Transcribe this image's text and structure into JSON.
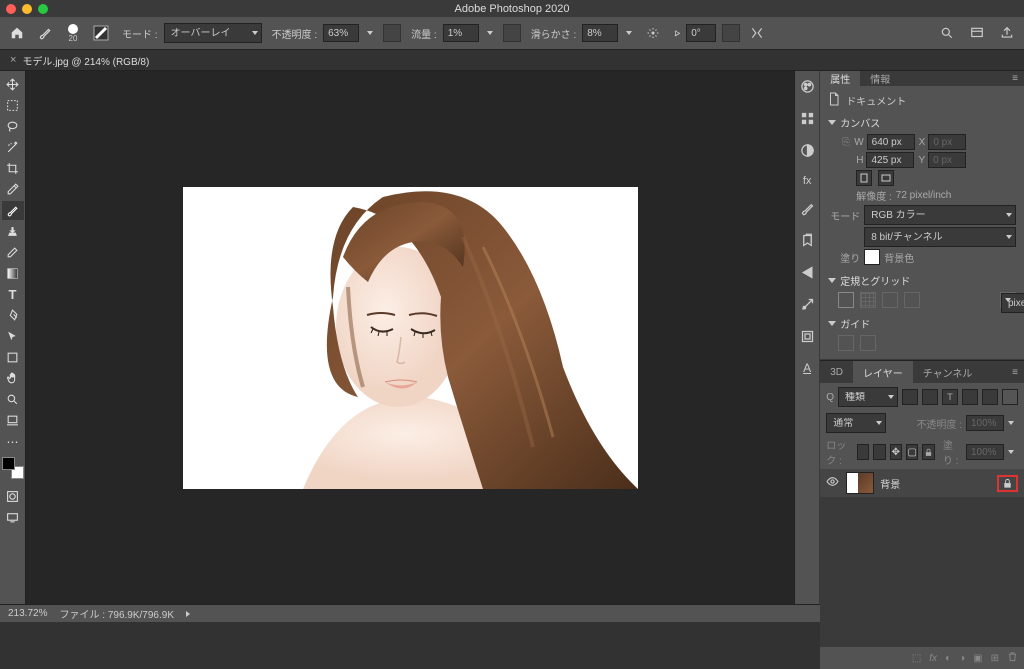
{
  "app_title": "Adobe Photoshop 2020",
  "document_tab": {
    "title": "モデル.jpg @ 214% (RGB/8)"
  },
  "options": {
    "brush_size": "20",
    "mode_label": "モード :",
    "mode_value": "オーバーレイ",
    "opacity_label": "不透明度 :",
    "opacity_value": "63%",
    "flow_label": "流量 :",
    "flow_value": "1%",
    "smoothing_label": "滑らかさ :",
    "smoothing_value": "8%",
    "angle_label": "⦠",
    "angle_value": "0°"
  },
  "properties": {
    "tab_properties": "属性",
    "tab_info": "情報",
    "doc_type": "ドキュメント",
    "canvas_label": "カンバス",
    "w_label": "W",
    "w_value": "640 px",
    "h_label": "H",
    "h_value": "425 px",
    "x_label": "X",
    "x_value": "0 px",
    "y_label": "Y",
    "y_value": "0 px",
    "resolution_label": "解像度 :",
    "resolution_value": "72 pixel/inch",
    "mode_label": "モード",
    "mode_value": "RGB カラー",
    "bit_value": "8 bit/チャンネル",
    "fill_label": "塗り",
    "fill_value": "背景色",
    "rulers_label": "定規とグリッド",
    "rulers_unit": "pixel",
    "guides_label": "ガイド"
  },
  "layers": {
    "tab_3d": "3D",
    "tab_layers": "レイヤー",
    "tab_channels": "チャンネル",
    "kind_label": "種類",
    "blend_mode": "通常",
    "opacity_label": "不透明度 :",
    "opacity_value": "100%",
    "lock_label": "ロック :",
    "fill_label": "塗り :",
    "fill_value": "100%",
    "layer_name": "背景"
  },
  "status": {
    "zoom": "213.72%",
    "file_label": "ファイル :",
    "file_size": "796.9K/796.9K"
  }
}
